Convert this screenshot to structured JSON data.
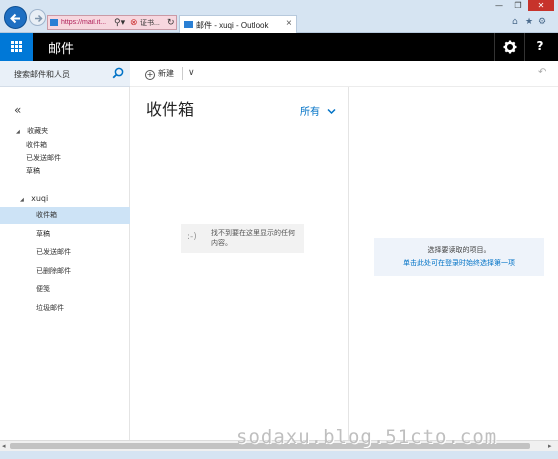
{
  "browser": {
    "address_url": "https://mail.it...",
    "address_cert_label": "证书...",
    "tab_title": "邮件 - xuqi - Outlook",
    "tab_close": "×",
    "window_buttons": [
      "—",
      "❐",
      "✕"
    ],
    "toolbar_icons": [
      "⌂",
      "★",
      "⚙"
    ]
  },
  "app": {
    "title": "邮件",
    "settings_icon": "gear-icon",
    "help_label": "?"
  },
  "search": {
    "placeholder": "搜索邮件和人员"
  },
  "toolbar": {
    "new_label": "新建",
    "new_dropdown": "∨"
  },
  "sidebar": {
    "collapse_label": "«",
    "favorites_label": "收藏夹",
    "favorites": [
      "收件箱",
      "已发送邮件",
      "草稿"
    ],
    "account_label": "xuqi",
    "folders": [
      "收件箱",
      "草稿",
      "已发送邮件",
      "已删除邮件",
      "便笺",
      "垃圾邮件"
    ],
    "selected_folder": "收件箱"
  },
  "message_list": {
    "folder_title": "收件箱",
    "filter_label": "所有",
    "empty_face": ":-)",
    "empty_text": "找不到要在这里显示的任何内容。"
  },
  "reading_pane": {
    "prompt": "选择要读取的项目。",
    "link": "单击此处可在登录时始终选择第一项"
  },
  "watermark": "sodaxu.blog.51cto.com",
  "colors": {
    "accent": "#0078d7",
    "header_bg": "#000000",
    "selected_bg": "#cde3f6",
    "link": "#0072c6"
  }
}
